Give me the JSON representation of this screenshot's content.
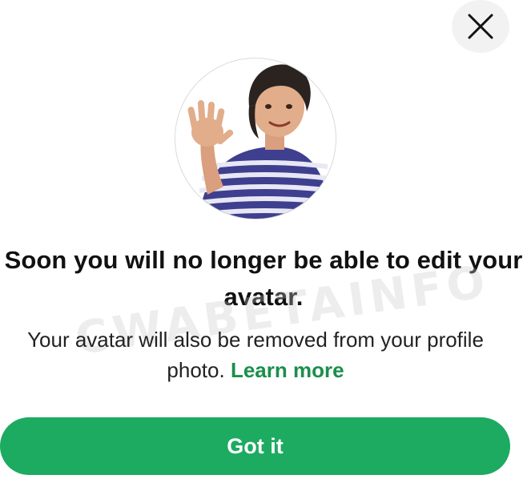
{
  "dialog": {
    "title": "Soon you will no longer be able to edit your avatar.",
    "description": "Your avatar will also be removed from your profile photo.",
    "learn_more": "Learn more",
    "button_label": "Got it",
    "watermark": "CWABETAINFO"
  },
  "icons": {
    "close": "close-icon",
    "avatar": "avatar-illustration"
  },
  "colors": {
    "accent": "#1daa61",
    "link": "#1a8f4b",
    "title": "#111111"
  }
}
